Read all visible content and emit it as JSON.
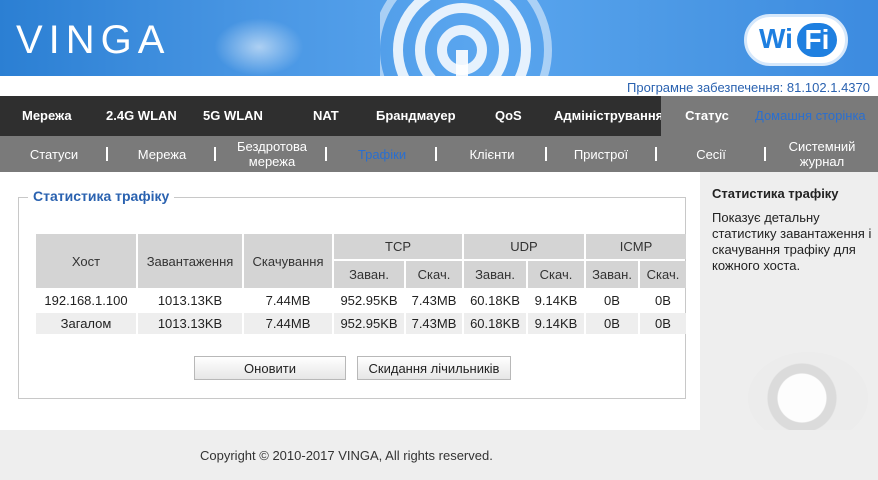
{
  "header": {
    "logo": "VINGA",
    "wifi_badge": {
      "left": "Wi",
      "right": "Fi"
    },
    "version": "Програмне забезпечення: 81.102.1.4370"
  },
  "main_nav": [
    {
      "label": "Мережа"
    },
    {
      "label": "2.4G WLAN"
    },
    {
      "label": "5G WLAN"
    },
    {
      "label": "NAT"
    },
    {
      "label": "Брандмауер"
    },
    {
      "label": "QoS"
    },
    {
      "label": "Адміністрування"
    },
    {
      "label": "Статус",
      "active": true
    },
    {
      "label": "Домашня сторінка"
    }
  ],
  "sub_nav": [
    {
      "label": "Статуси"
    },
    {
      "label": "Мережа"
    },
    {
      "label": "Бездротова мережа"
    },
    {
      "label": "Трафіки",
      "active": true
    },
    {
      "label": "Клієнти"
    },
    {
      "label": "Пристрої"
    },
    {
      "label": "Сесії"
    },
    {
      "label": "Системний журнал"
    }
  ],
  "section": {
    "title": "Статистика трафіку",
    "table": {
      "headers": {
        "host": "Хост",
        "upload": "Завантаження",
        "download": "Скачування",
        "tcp": "TCP",
        "udp": "UDP",
        "icmp": "ICMP",
        "up": "Заван.",
        "down": "Скач."
      },
      "rows": [
        [
          "192.168.1.100",
          "1013.13KB",
          "7.44MB",
          "952.95KB",
          "7.43MB",
          "60.18KB",
          "9.14KB",
          "0B",
          "0B"
        ],
        [
          "Загалом",
          "1013.13KB",
          "7.44MB",
          "952.95KB",
          "7.43MB",
          "60.18KB",
          "9.14KB",
          "0B",
          "0B"
        ]
      ]
    },
    "buttons": {
      "refresh": "Оновити",
      "reset": "Скидання лічильників"
    }
  },
  "help": {
    "title": "Статистика трафіку",
    "text": "Показує детальну статистику завантаження і скачування трафіку для кожного хоста."
  },
  "footer": {
    "copyright": "Copyright © 2010-2017 VINGA, All rights reserved."
  },
  "colors": {
    "banner": "#4a97e4",
    "nav_dark": "#2f2f2f",
    "nav_active": "#7a7a7a",
    "link_blue": "#2a6fd0",
    "legend_blue": "#2a62b0"
  }
}
